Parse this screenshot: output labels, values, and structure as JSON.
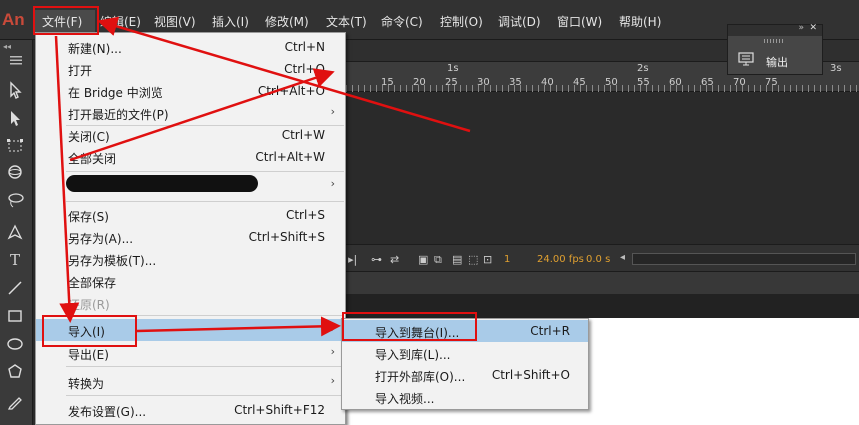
{
  "app": {
    "logo": "An"
  },
  "menubar": {
    "items": [
      {
        "label": "文件(F)",
        "active": true
      },
      {
        "label": "编辑(E)"
      },
      {
        "label": "视图(V)"
      },
      {
        "label": "插入(I)"
      },
      {
        "label": "修改(M)"
      },
      {
        "label": "文本(T)"
      },
      {
        "label": "命令(C)"
      },
      {
        "label": "控制(O)"
      },
      {
        "label": "调试(D)"
      },
      {
        "label": "窗口(W)"
      },
      {
        "label": "帮助(H)"
      }
    ]
  },
  "file_menu": {
    "items": [
      {
        "label": "新建(N)...",
        "shortcut": "Ctrl+N"
      },
      {
        "label": "打开",
        "shortcut": "Ctrl+O"
      },
      {
        "label": "在 Bridge 中浏览",
        "shortcut": "Ctrl+Alt+O"
      },
      {
        "label": "打开最近的文件(P)",
        "submenu": true
      },
      {
        "label": "关闭(C)",
        "shortcut": "Ctrl+W"
      },
      {
        "label": "全部关闭",
        "shortcut": "Ctrl+Alt+W"
      },
      {
        "label": "",
        "submenu": true,
        "redacted": true
      },
      {
        "label": "保存(S)",
        "shortcut": "Ctrl+S"
      },
      {
        "label": "另存为(A)...",
        "shortcut": "Ctrl+Shift+S"
      },
      {
        "label": "另存为模板(T)..."
      },
      {
        "label": "全部保存"
      },
      {
        "label": "还原(R)",
        "disabled": true
      },
      {
        "label": "导入(I)",
        "submenu": true,
        "highlighted": true
      },
      {
        "label": "导出(E)",
        "submenu": true
      },
      {
        "label": "转换为",
        "submenu": true
      },
      {
        "label": "发布设置(G)...",
        "shortcut": "Ctrl+Shift+F12"
      }
    ]
  },
  "import_submenu": {
    "items": [
      {
        "label": "导入到舞台(I)...",
        "shortcut": "Ctrl+R",
        "highlighted": true
      },
      {
        "label": "导入到库(L)..."
      },
      {
        "label": "打开外部库(O)...",
        "shortcut": "Ctrl+Shift+O"
      },
      {
        "label": "导入视频..."
      }
    ]
  },
  "output_panel": {
    "label": "输出",
    "icon": "monitor-icon"
  },
  "timeline": {
    "seconds": [
      "1s",
      "2s",
      "3s"
    ],
    "frame_numbers": [
      "15",
      "20",
      "25",
      "30",
      "35",
      "40",
      "45",
      "50",
      "55",
      "60",
      "65",
      "70",
      "75"
    ],
    "current_frame": "1",
    "fps": "24.00 fps",
    "time": "0.0 s"
  },
  "tools": [
    "selection-tool-icon",
    "subselection-tool-icon",
    "free-transform-icon",
    "3d-rotation-icon",
    "lasso-icon",
    "pen-icon",
    "text-tool-icon",
    "line-tool-icon",
    "rectangle-tool-icon",
    "oval-tool-icon",
    "polystar-tool-icon",
    "pencil-icon"
  ],
  "colors": {
    "annotation_red": "#e01010",
    "menu_highlight": "#a9cbe8",
    "logo_red": "#c94a3a"
  }
}
